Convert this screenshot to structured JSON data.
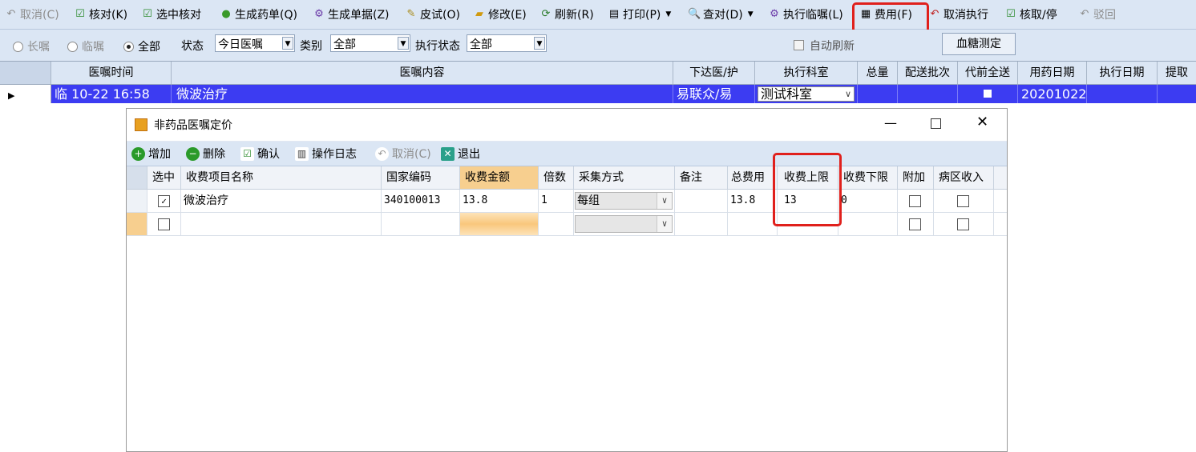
{
  "toolbar": {
    "items": [
      {
        "label": "取消(C)",
        "icon": "undo-icon",
        "enabled": false
      },
      {
        "label": "核对(K)",
        "icon": "checkmark-icon",
        "enabled": true
      },
      {
        "label": "选中核对",
        "icon": "checkmark-icon",
        "enabled": true
      },
      {
        "label": "生成药单(Q)",
        "icon": "pills-icon",
        "enabled": true
      },
      {
        "label": "生成单据(Z)",
        "icon": "gear-icon",
        "enabled": true
      },
      {
        "label": "皮试(O)",
        "icon": "syringe-icon",
        "enabled": true
      },
      {
        "label": "修改(E)",
        "icon": "edit-icon",
        "enabled": true
      },
      {
        "label": "刷新(R)",
        "icon": "refresh-icon",
        "enabled": true
      },
      {
        "label": "打印(P)",
        "icon": "printer-icon",
        "enabled": true
      },
      {
        "label": "查对(D)",
        "icon": "search-icon",
        "enabled": true
      },
      {
        "label": "执行临嘱(L)",
        "icon": "gear-icon",
        "enabled": true
      },
      {
        "label": "费用(F)",
        "icon": "calculator-icon",
        "enabled": true
      },
      {
        "label": "取消执行",
        "icon": "undo-icon",
        "enabled": true
      },
      {
        "label": "核取/停",
        "icon": "checkmark-icon",
        "enabled": true
      },
      {
        "label": "驳回",
        "icon": "undo-icon",
        "enabled": false
      }
    ]
  },
  "filter": {
    "long_order": "长嘱",
    "temp_order": "临嘱",
    "all": "全部",
    "status_label": "状态",
    "status_value": "今日医嘱",
    "category_label": "类别",
    "category_value": "全部",
    "exec_status_label": "执行状态",
    "exec_status_value": "全部",
    "auto_refresh": "自动刷新",
    "blood_sugar": "血糖测定"
  },
  "grid": {
    "headers": [
      "医嘱时间",
      "医嘱内容",
      "下达医/护",
      "执行科室",
      "总量",
      "配送批次",
      "代前全送",
      "用药日期",
      "执行日期",
      "提取"
    ],
    "row": {
      "type": "临",
      "time": "10-22 16:58",
      "content": "微波治疗",
      "doctor": "易联众/易",
      "dept": "测试科室",
      "date": "20201022"
    }
  },
  "dialog": {
    "title": "非药品医嘱定价",
    "toolbar": {
      "add": "增加",
      "delete": "删除",
      "confirm": "确认",
      "log": "操作日志",
      "cancel": "取消(C)",
      "exit": "退出"
    },
    "headers": [
      "选中",
      "收费项目名称",
      "国家编码",
      "收费金额",
      "倍数",
      "采集方式",
      "备注",
      "总费用",
      "收费上限",
      "收费下限",
      "附加",
      "病区收入",
      ""
    ],
    "rows": [
      {
        "selected": true,
        "name": "微波治疗",
        "code": "340100013",
        "amount": "13.8",
        "multiple": "1",
        "method": "每组",
        "note": "",
        "total": "13.8",
        "upper": "13",
        "lower": "0"
      },
      {
        "selected": false,
        "name": "",
        "code": "",
        "amount": "",
        "multiple": "",
        "method": "",
        "note": "",
        "total": "",
        "upper": "",
        "lower": ""
      }
    ]
  },
  "colors": {
    "highlight": "#e0201c",
    "selected_row": "#3c3cf2",
    "toolbar_bg": "#dbe6f4",
    "amount_header": "#f7cf8f"
  }
}
